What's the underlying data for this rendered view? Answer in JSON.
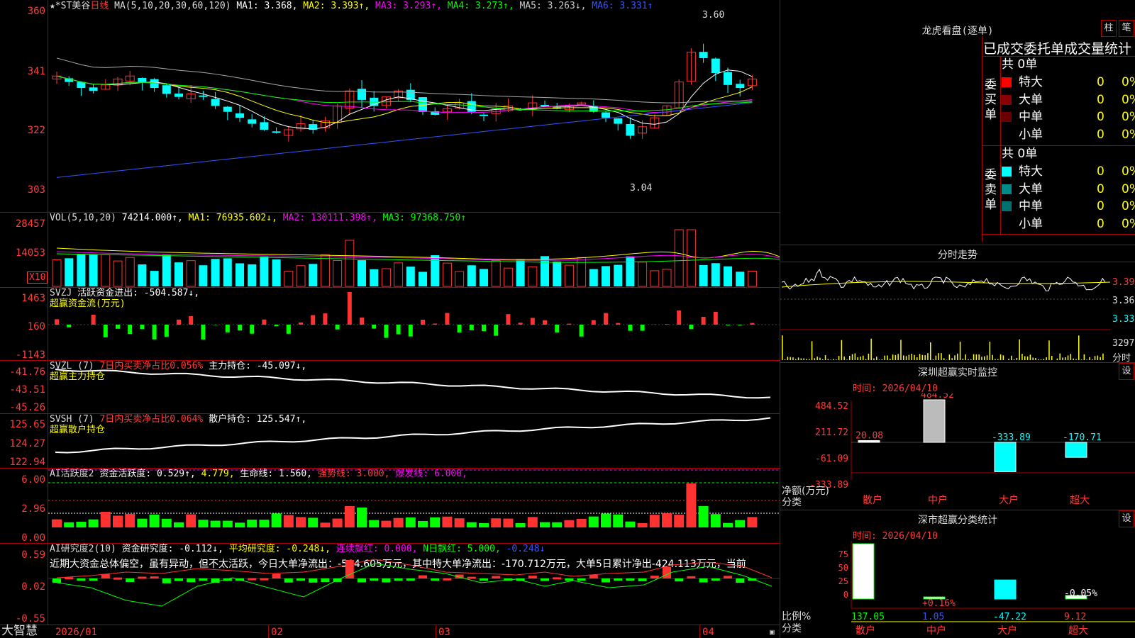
{
  "main_chart": {
    "legend": {
      "stock_name": "★*ST美谷",
      "period": "日线",
      "ma_param": "MA(5,10,20,30,60,120)",
      "ma1": "MA1: 3.368,",
      "ma2": "MA2: 3.393↑,",
      "ma3": "MA3: 3.293↑,",
      "ma4": "MA4: 3.273↑,",
      "ma5": "MA5: 3.263↓,",
      "ma6": "MA6: 3.331↑"
    },
    "y_labels": [
      "360",
      "341",
      "322",
      "303"
    ],
    "high_label": "3.60",
    "low_label": "3.04"
  },
  "vol_panel": {
    "legend": {
      "name": "VOL(5,10,20)",
      "val": "74214.000↑,",
      "ma1": "MA1: 76935.602↓,",
      "ma2": "MA2: 130111.398↑,",
      "ma3": "MA3: 97368.750↑"
    },
    "y_labels": [
      "28457",
      "14053"
    ],
    "unit": "X10"
  },
  "svzj_panel": {
    "legend": {
      "name": "SVZJ",
      "desc": "活跃资金进出: -504.587↓,",
      "subtitle": "超赢资金流(万元)"
    },
    "y_labels": [
      "1463",
      "160",
      "-1143"
    ]
  },
  "svzl_panel": {
    "legend": {
      "name": "SVZL (7)",
      "desc": "7日内买卖净占比0.056%",
      "value": "主力持仓: -45.097↓,",
      "subtitle": "超赢主力持仓"
    },
    "y_labels": [
      "-41.76",
      "-43.51",
      "-45.26"
    ]
  },
  "svsh_panel": {
    "legend": {
      "name": "SVSH (7)",
      "desc": "7日内买卖净占比0.064%",
      "value": "散户持仓: 125.547↑,",
      "subtitle": "超赢散户持仓"
    },
    "y_labels": [
      "125.65",
      "124.27",
      "122.94"
    ]
  },
  "ai_active_panel": {
    "legend": {
      "name": "AI活跃度2",
      "a": "资金活跃度: 0.529↑,",
      "b": "4.779,",
      "c": "生命线: 1.560,",
      "d": "强势线: 3.000,",
      "e": "爆发线: 6.000,"
    },
    "y_labels": [
      "6.00",
      "2.96",
      "0.00"
    ]
  },
  "ai_research_panel": {
    "legend": {
      "name": "AI研究度2(10)",
      "a": "资金研究度: -0.112↓,",
      "b": "平均研究度: -0.248↓,",
      "c": "连续飘红: 0.000,",
      "d": "N日飘红: 5.000,",
      "e": "-0.248↓"
    },
    "comment": "近期大资金总体偏空，虽有异动，但不太活跃，今日大单净流出：-504.605万元，其中特大单净流出：-170.712万元，大单5日累计净出-424.113万元，当前",
    "y_labels": [
      "0.59",
      "0.02",
      "-0.55"
    ]
  },
  "bottom_bar": {
    "brand": "大智慧",
    "dates": [
      "2026/01",
      "02",
      "03",
      "04"
    ]
  },
  "right_panel": {
    "dragon": {
      "title": "龙虎看盘(逐单)",
      "btn_a": "柱",
      "btn_b": "笔",
      "subtitle": "已成交委托单成交量统计",
      "buy_label": "委买单",
      "sell_label": "委卖单",
      "buy_total": "共 0单",
      "sell_total": "共 0单",
      "buy_rows": [
        {
          "name": "特大",
          "count": "0",
          "pct": "0%",
          "color": "#ff0000"
        },
        {
          "name": "大单",
          "count": "0",
          "pct": "0%",
          "color": "#8b0000"
        },
        {
          "name": "中单",
          "count": "0",
          "pct": "0%",
          "color": "#6a0000"
        },
        {
          "name": "小单",
          "count": "0",
          "pct": "0%",
          "color": ""
        }
      ],
      "sell_rows": [
        {
          "name": "特大",
          "count": "0",
          "pct": "0%",
          "color": "#00ffff"
        },
        {
          "name": "大单",
          "count": "0",
          "pct": "0%",
          "color": "#008b8b"
        },
        {
          "name": "中单",
          "count": "0",
          "pct": "0%",
          "color": "#007070"
        },
        {
          "name": "小单",
          "count": "0",
          "pct": "0%",
          "color": ""
        }
      ]
    },
    "minute": {
      "title": "分时走势",
      "prices": [
        "3.390",
        "3.360",
        "3.330"
      ],
      "vol_label": "3297",
      "vol_unit": "分时"
    },
    "monitor": {
      "title": "深圳超赢实时监控",
      "btn": "设",
      "time": "时间: 2026/04/10",
      "y_labels": [
        "484.52",
        "211.72",
        "-61.09",
        "-333.89"
      ],
      "bottom_label_a": "净额(万元)",
      "bottom_label_b": "分类",
      "categories": [
        "散户",
        "中户",
        "大户",
        "超大"
      ],
      "values": [
        "20.08",
        "484.52",
        "-333.89",
        "-170.71"
      ]
    },
    "classify": {
      "title": "深市超赢分类统计",
      "btn": "设",
      "time": "时间: 2026/04/10",
      "y_labels": [
        "75",
        "50",
        "25",
        "0"
      ],
      "label_a": "比例%",
      "label_b": "分类",
      "categories": [
        "散户",
        "中户",
        "大户",
        "超大"
      ],
      "values": [
        "137.05",
        "1.05",
        "-47.22",
        "9.12"
      ],
      "annotations": [
        "+0.16%",
        "-0.05%"
      ]
    }
  }
}
